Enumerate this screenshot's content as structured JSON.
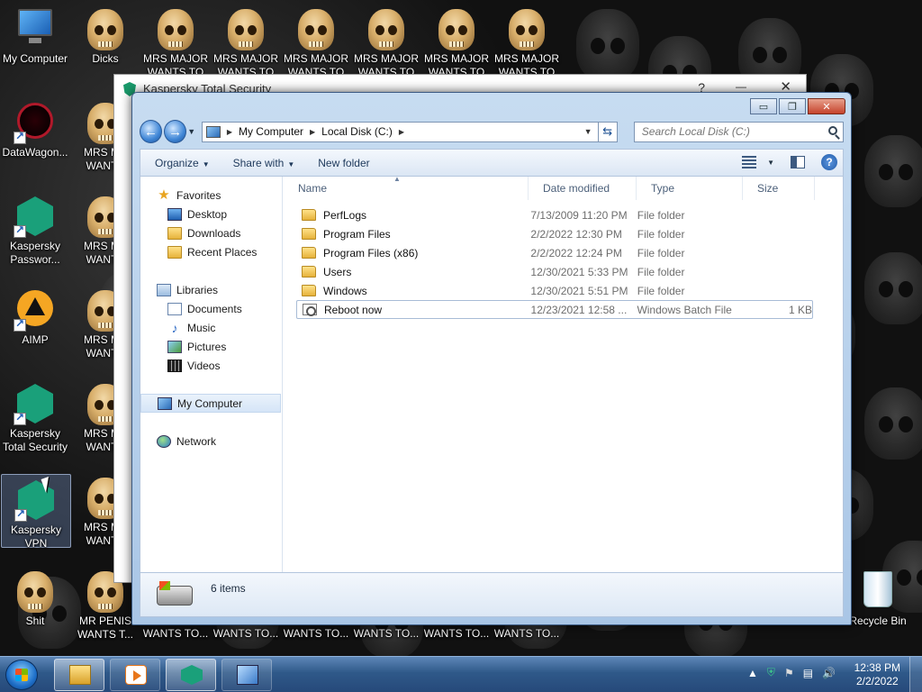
{
  "desktop": {
    "icons": [
      {
        "label": "My Computer",
        "icon": "computer-icon"
      },
      {
        "label": "Dicks",
        "icon": "skull-icon"
      },
      {
        "label": "MRS MAJOR WANTS TO",
        "icon": "skull-icon"
      },
      {
        "label": "MRS MAJOR WANTS TO",
        "icon": "skull-icon"
      },
      {
        "label": "MRS MAJOR WANTS TO",
        "icon": "skull-icon"
      },
      {
        "label": "MRS MAJOR WANTS TO",
        "icon": "skull-icon"
      },
      {
        "label": "MRS MAJOR WANTS TO",
        "icon": "skull-icon"
      },
      {
        "label": "MRS MAJOR WANTS TO",
        "icon": "skull-icon"
      },
      {
        "label": "DataWagon...",
        "icon": "pentagram-icon"
      },
      {
        "label": "MRS MA WANTS",
        "icon": "skull-icon"
      },
      {
        "label": "Kaspersky Passwor...",
        "icon": "kaspersky-password-icon"
      },
      {
        "label": "MRS MA WANTS",
        "icon": "skull-icon"
      },
      {
        "label": "AIMP",
        "icon": "aimp-icon"
      },
      {
        "label": "MRS MA WANTS",
        "icon": "skull-icon"
      },
      {
        "label": "Kaspersky Total Security",
        "icon": "kaspersky-icon"
      },
      {
        "label": "MRS MA WANTS",
        "icon": "skull-icon"
      },
      {
        "label": "Kaspersky VPN",
        "icon": "kaspersky-vpn-icon"
      },
      {
        "label": "MRS MA WANTS",
        "icon": "skull-icon"
      },
      {
        "label": "Shit",
        "icon": "skull-icon"
      },
      {
        "label": "MR PENIS WANTS T...",
        "icon": "skull-icon"
      },
      {
        "label": "Recycle Bin",
        "icon": "recycle-bin-icon"
      }
    ],
    "bottom_labels": [
      "WANTS TO...",
      "WANTS TO...",
      "WANTS TO...",
      "WANTS TO...",
      "WANTS TO...",
      "WANTS TO..."
    ]
  },
  "background_window": {
    "title": "Kaspersky Total Security",
    "help": "?",
    "minimize": "—",
    "close": "✕"
  },
  "explorer": {
    "window_buttons": {
      "minimize": "▭",
      "maximize": "❐",
      "close": "✕"
    },
    "address": {
      "segments": [
        "My Computer",
        "Local Disk (C:)"
      ]
    },
    "search": {
      "placeholder": "Search Local Disk (C:)"
    },
    "toolbar": {
      "organize": "Organize",
      "share_with": "Share with",
      "new_folder": "New folder",
      "help": "?"
    },
    "nav": {
      "favorites": "Favorites",
      "favorites_items": [
        "Desktop",
        "Downloads",
        "Recent Places"
      ],
      "libraries": "Libraries",
      "libraries_items": [
        "Documents",
        "Music",
        "Pictures",
        "Videos"
      ],
      "my_computer": "My Computer",
      "network": "Network"
    },
    "columns": {
      "name": "Name",
      "date": "Date modified",
      "type": "Type",
      "size": "Size"
    },
    "files": [
      {
        "name": "PerfLogs",
        "date": "7/13/2009 11:20 PM",
        "type": "File folder",
        "size": "",
        "icon": "folder-icon"
      },
      {
        "name": "Program Files",
        "date": "2/2/2022 12:30 PM",
        "type": "File folder",
        "size": "",
        "icon": "folder-icon"
      },
      {
        "name": "Program Files (x86)",
        "date": "2/2/2022 12:24 PM",
        "type": "File folder",
        "size": "",
        "icon": "folder-icon"
      },
      {
        "name": "Users",
        "date": "12/30/2021 5:33 PM",
        "type": "File folder",
        "size": "",
        "icon": "folder-icon"
      },
      {
        "name": "Windows",
        "date": "12/30/2021 5:51 PM",
        "type": "File folder",
        "size": "",
        "icon": "folder-icon"
      },
      {
        "name": "Reboot now",
        "date": "12/23/2021 12:58 ...",
        "type": "Windows Batch File",
        "size": "1 KB",
        "icon": "batch-file-icon"
      }
    ],
    "details": {
      "count": "6 items"
    }
  },
  "taskbar": {
    "time": "12:38 PM",
    "date": "2/2/2022",
    "tray_arrow": "▲"
  }
}
